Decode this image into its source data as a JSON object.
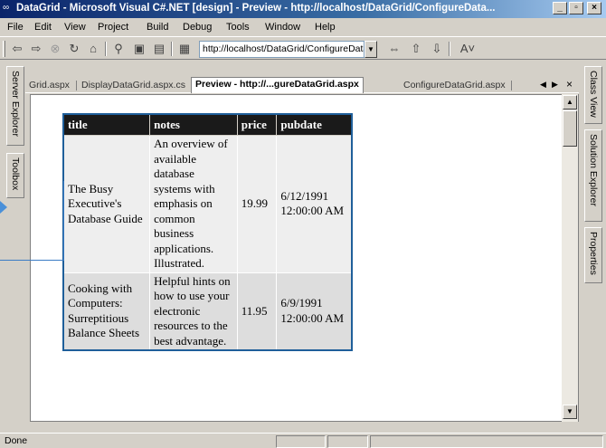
{
  "window": {
    "title": "DataGrid - Microsoft Visual C#.NET [design] - Preview - http://localhost/DataGrid/ConfigureData...",
    "app_icon": "vs-icon",
    "controls": [
      "_",
      "▫",
      "×"
    ]
  },
  "menu": [
    "File",
    "Edit",
    "View",
    "Project",
    "Build",
    "Debug",
    "Tools",
    "Window",
    "Help"
  ],
  "toolbar": {
    "url": "http://localhost/DataGrid/ConfigureDataGr",
    "icons": [
      "back-icon",
      "forward-icon",
      "stop-icon",
      "refresh-icon",
      "home-icon",
      "search-icon",
      "favorites-icon",
      "history-icon",
      "sync-icon",
      "prev-page-icon",
      "next-page-icon",
      "font-size-icon"
    ]
  },
  "left_panel": [
    "Server Explorer",
    "Toolbox"
  ],
  "right_panel": [
    "Class View",
    "Solution Explorer",
    "Properties"
  ],
  "tabs": [
    {
      "label": "Grid.aspx",
      "active": false
    },
    {
      "label": "DisplayDataGrid.aspx.cs",
      "active": false
    },
    {
      "label": "Preview - http://...gureDataGrid.aspx",
      "active": true
    },
    {
      "label": "ConfigureDataGrid.aspx",
      "active": false
    }
  ],
  "grid": {
    "columns": [
      "title",
      "notes",
      "price",
      "pubdate"
    ],
    "rows": [
      {
        "title": "The Busy Executive's Database Guide",
        "notes": "An overview of available database systems with emphasis on common business applications. Illustrated.",
        "price": "19.99",
        "pubdate": "6/12/1991 12:00:00 AM"
      },
      {
        "title": "Cooking with Computers: Surreptitious Balance Sheets",
        "notes": "Helpful hints on how to use your electronic resources to the best advantage.",
        "price": "11.95",
        "pubdate": "6/9/1991 12:00:00 AM"
      }
    ]
  },
  "status": {
    "text": "Done"
  },
  "colors": {
    "titlebar": "#0a246a",
    "grid_border": "#1f5f9a",
    "header_bg": "#1a1a1a",
    "callout": "#4a90d9"
  }
}
